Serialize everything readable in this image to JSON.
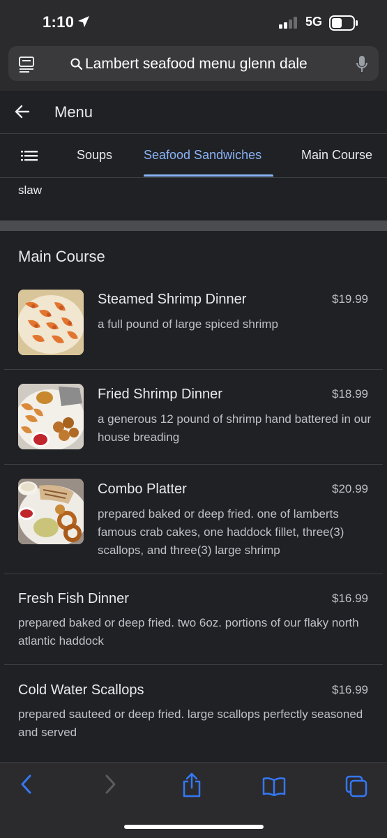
{
  "status": {
    "time": "1:10",
    "network": "5G"
  },
  "browser": {
    "url_text": "Lambert seafood menu glenn dale"
  },
  "header": {
    "title": "Menu"
  },
  "tabs": [
    {
      "label": "Soups"
    },
    {
      "label": "Seafood Sandwiches",
      "active": true
    },
    {
      "label": "Main Course"
    }
  ],
  "previous_item_tail": "slaw",
  "section": {
    "title": "Main Course"
  },
  "items": [
    {
      "name": "Steamed Shrimp Dinner",
      "price": "$19.99",
      "desc": "a full pound of large spiced shrimp"
    },
    {
      "name": "Fried Shrimp Dinner",
      "price": "$18.99",
      "desc": "a generous 12 pound of shrimp hand battered in our house breading"
    },
    {
      "name": "Combo Platter",
      "price": "$20.99",
      "desc": "prepared baked or deep fried. one of lamberts famous crab cakes, one haddock fillet, three(3) scallops, and three(3) large shrimp"
    },
    {
      "name": "Fresh Fish Dinner",
      "price": "$16.99",
      "desc": "prepared baked or deep fried. two 6oz. portions of our flaky north atlantic haddock"
    },
    {
      "name": "Cold Water Scallops",
      "price": "$16.99",
      "desc": "prepared sauteed or deep fried. large scallops perfectly seasoned and served"
    }
  ],
  "colors": {
    "accent": "#8ab4f8",
    "background": "#202124",
    "ios_blue": "#3478f6"
  },
  "icons": [
    "location-arrow-icon",
    "signal-icon",
    "battery-icon",
    "reader-icon",
    "search-icon",
    "mic-icon",
    "back-arrow-icon",
    "list-icon",
    "browser-back-icon",
    "browser-forward-icon",
    "share-icon",
    "bookmarks-icon",
    "tabs-icon"
  ]
}
